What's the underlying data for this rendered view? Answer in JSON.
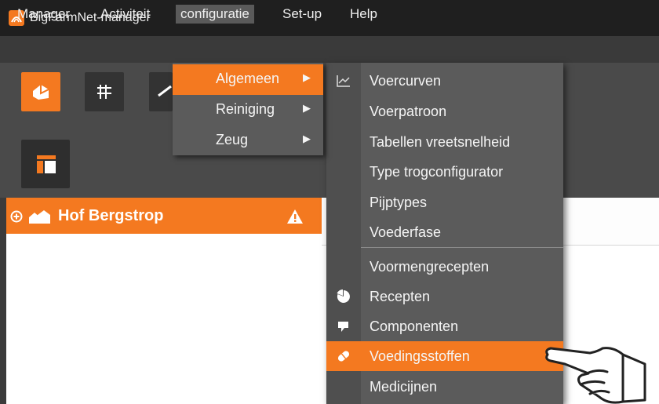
{
  "app": {
    "title": "BigFarmNet-manager"
  },
  "menubar": {
    "items": [
      {
        "label": "Manager"
      },
      {
        "label": "Activiteit"
      },
      {
        "label": "configuratie"
      },
      {
        "label": "Set-up"
      },
      {
        "label": "Help"
      }
    ],
    "active": "configuratie"
  },
  "toolbar": {
    "buttons": [
      {
        "icon": "farm-building-icon"
      },
      {
        "icon": "grid-table-icon"
      },
      {
        "icon": "chart-icon"
      },
      {
        "icon": "layout-panel-icon"
      }
    ]
  },
  "side_panel": {
    "farm_name": "Hof Bergstrop",
    "expand_icon": "expand-plus-icon",
    "farm_icon": "barn-icon",
    "warning_icon": "warning-triangle-icon"
  },
  "config_menu": {
    "items": [
      {
        "label": "Algemeen",
        "active": true
      },
      {
        "label": "Reiniging",
        "active": false
      },
      {
        "label": "Zeug",
        "active": false
      }
    ]
  },
  "algemeen_submenu": {
    "items": [
      {
        "label": "Voercurven",
        "icon": "line-chart-icon"
      },
      {
        "label": "Voerpatroon",
        "icon": ""
      },
      {
        "label": "Tabellen vreetsnelheid",
        "icon": ""
      },
      {
        "label": "Type trogconfigurator",
        "icon": ""
      },
      {
        "label": "Pijptypes",
        "icon": ""
      },
      {
        "label": "Voederfase",
        "icon": ""
      },
      {
        "label": "Voormengrecepten",
        "icon": ""
      },
      {
        "label": "Recepten",
        "icon": "pie-chart-icon"
      },
      {
        "label": "Componenten",
        "icon": "component-icon"
      },
      {
        "label": "Voedingsstoffen",
        "icon": "capsule-icon",
        "active": true
      },
      {
        "label": "Medicijnen",
        "icon": ""
      }
    ]
  },
  "colors": {
    "accent": "#f47920",
    "menu_bg": "#5b5b5b",
    "titlebar": "#1f1f1f",
    "toolbar": "#4a4a4a"
  }
}
